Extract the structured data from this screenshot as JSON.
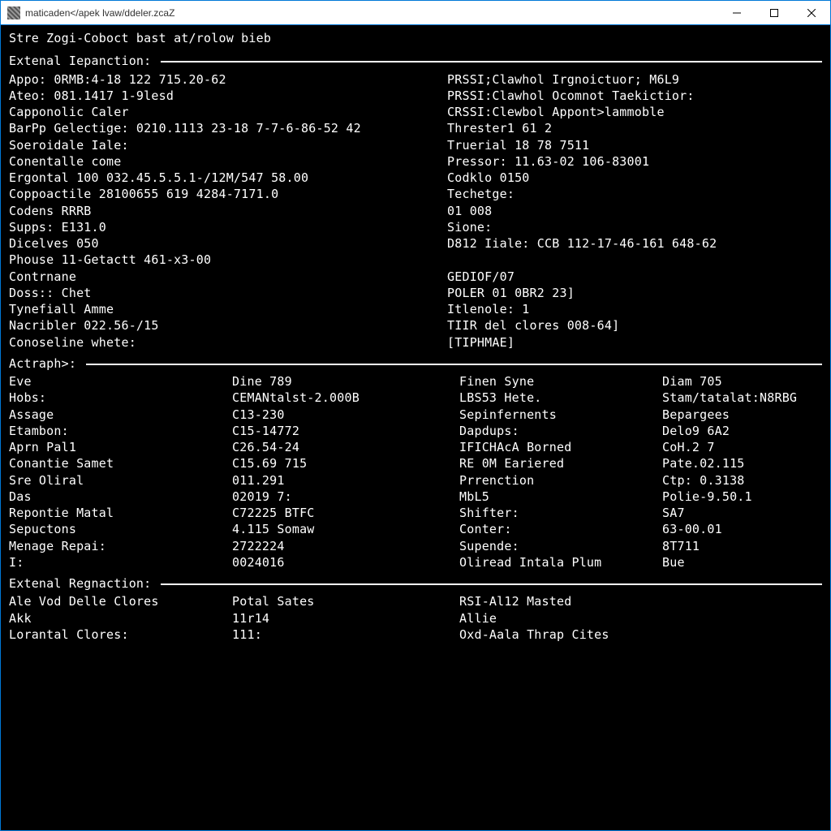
{
  "window": {
    "title": "maticaden</apek lvaw/ddeler.zcaZ"
  },
  "terminal": {
    "header": "Stre Zogi-Coboct bast at/rolow bieb",
    "section1_label": "Extenal Iepanction:",
    "section2_label": "Actraph>:",
    "section3_label": "Extenal Regnaction:",
    "left1": [
      "Appo: 0RMB:4-18 122 715.20-62",
      "Ateo: 081.1417 1-9lesd",
      "Capponolic Caler",
      "BarPp Gelectige: 0210.1113 23-18 7-7-6-86-52 42",
      "Soeroidale Iale:",
      "Conentalle come",
      "Ergontal 100 032.45.5.5.1-/12M/547 58.00",
      "Coppoactile 28100655 619 4284-7171.0",
      "Codens RRRB",
      "Supps: E131.0",
      "Dicelves 050",
      "Phouse 11-Getactt 461-x3-00",
      "Contrnane",
      "Doss:: Chet",
      "Tynefiall Amme",
      "Nacribler 022.56-/15",
      "Conoseline whete:"
    ],
    "right1": [
      "PRSSI;Clawhol Irgnoictuor; M6L9",
      "PRSSI:Clawhol Ocomnot Taekictior:",
      "CRSSI:Clewbol Appont>lammoble",
      "Threster1 61 2",
      "Truerial 18 78 7511",
      "Pressor: 11.63-02 106-83001",
      "Codklo 0150",
      "Techetge:",
      "01 008",
      "Sione:",
      "D812 Iiale: CCB 112-17-46-161 648-62",
      "",
      "GEDIOF/07",
      "POLER 01 0BR2 23]",
      "Itlenole: 1",
      "TIIR del clores 008-64]",
      "[TIPHMAE]"
    ],
    "atraph": {
      "c1": [
        "Eve",
        "Hobs:",
        "Assage",
        "Etambon:",
        "Aprn Pal1",
        "Conantie Samet",
        "Sre Oliral",
        "Das",
        "Repontie Matal",
        "Sepuctons",
        "Menage Repai:",
        "I:"
      ],
      "c2": [
        "Dine 789",
        "CEMANtalst-2.000B",
        "C13-230",
        "C15-14772",
        "C26.54-24",
        "C15.69 715",
        "011.291",
        "02019 7:",
        "C72225 BTFC",
        "4.115 Somaw",
        "2722224",
        "0024016"
      ],
      "c3": [
        "Finen Syne",
        "LBS53 Hete.",
        "Sepinfernents",
        "Dapdups:",
        "IFICHAcA Borned",
        "RE 0M Eariered",
        "Prrenction",
        "MbL5",
        "Shifter:",
        "Conter:",
        "Supende:",
        "Oliread Intala Plum"
      ],
      "c4": [
        "Diam 705",
        "Stam/tatalat:N8RBG",
        "Bepargees",
        "Delo9 6A2",
        "CoH.2 7",
        "Pate.02.115",
        "Ctp: 0.3138",
        "Polie-9.50.1",
        "SA7",
        "63-00.01",
        "8T711",
        "Bue"
      ]
    },
    "reg": {
      "c1": [
        "Ale Vod Delle Clores",
        "Akk",
        "Lorantal Clores:"
      ],
      "c2": [
        "Potal Sates",
        "11r14",
        "111:"
      ],
      "c3": [
        "RSI-Al12 Masted",
        "Allie",
        "Oxd-Aala Thrap Cites"
      ]
    }
  }
}
